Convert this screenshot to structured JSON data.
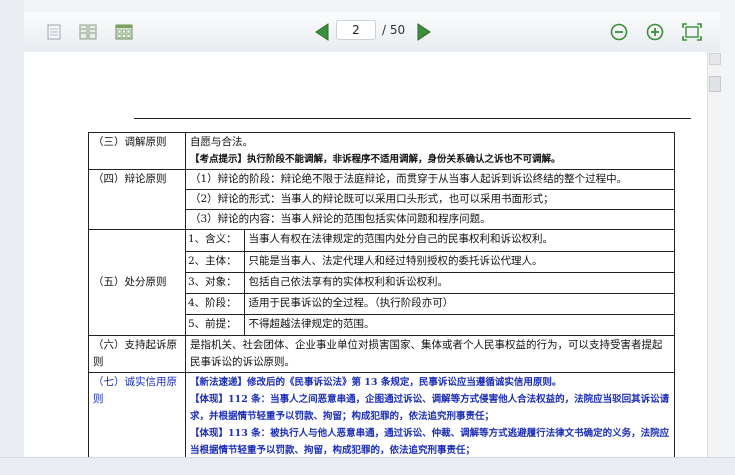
{
  "toolbar": {
    "icons": [
      "single-page-icon",
      "two-page-icon",
      "thumbnail-grid-icon"
    ],
    "prev_icon": "arrow-left-icon",
    "next_icon": "arrow-right-icon",
    "page_current": "2",
    "page_total": "/ 50",
    "zoom_out_icon": "zoom-out-icon",
    "zoom_in_icon": "zoom-in-icon",
    "fullscreen_icon": "fullscreen-icon",
    "accent": "#3c8f3a"
  },
  "doc": {
    "rows": [
      {
        "head": "（三）调解原则",
        "lines": [
          {
            "text": "自愿与合法。"
          },
          {
            "text": "【考点提示】执行阶段不能调解，非诉程序不适用调解，身份关系确认之诉也不可调解。",
            "small": true
          }
        ]
      },
      {
        "head": "（四）辩论原则",
        "lines": [
          {
            "text": "（1）辩论的阶段：辩论绝不限于法庭辩论，而贯穿于从当事人起诉到诉讼终结的整个过程中。"
          },
          {
            "text": "（2）辩论的形式：当事人的辩论既可以采用口头形式，也可以采用书面形式；"
          },
          {
            "text": "（3）辩论的内容：当事人辩论的范围包括实体问题和程序问题。"
          }
        ]
      },
      {
        "head": "（五）处分原则",
        "items": [
          {
            "k": "1、含义：",
            "v": "当事人有权在法律规定的范围内处分自己的民事权利和诉讼权利。"
          },
          {
            "k": "2、主体：",
            "v": "只能是当事人、法定代理人和经过特别授权的委托诉讼代理人。"
          },
          {
            "k": "3、对象：",
            "v": "包括自己依法享有的实体权利和诉讼权利。"
          },
          {
            "k": "4、阶段：",
            "v": "适用于民事诉讼的全过程。（执行阶段亦可）"
          },
          {
            "k": "5、前提：",
            "v": "不得超越法律规定的范围。"
          }
        ]
      },
      {
        "head": "（六）支持起诉原则",
        "lines": [
          {
            "text": "是指机关、社会团体、企业事业单位对损害国家、集体或者个人民事权益的行为，可以支持受害者提起民事诉讼的诉讼原则。"
          }
        ]
      },
      {
        "head": "（七）诚实信用原则",
        "blue": true,
        "lines": [
          {
            "text": "【新法速递】修改后的《民事诉讼法》第 13 条规定，民事诉讼应当遵循诚实信用原则。",
            "small": true
          },
          {
            "text": "【体现】112 条：当事人之间恶意串通，企图通过诉讼、调解等方式侵害他人合法权益的，法院应当驳回其诉讼请求，并根据情节轻重予以罚款、拘留；构成犯罪的，依法追究刑事责任；",
            "small": true
          },
          {
            "text": "【体现】113 条：被执行人与他人恶意串通，通过诉讼、仲裁、调解等方式逃避履行法律文书确定的义务，法院应当根据情节轻重予以罚款、拘留，构成犯罪的，依法追究刑事责任；",
            "small": true
          }
        ]
      }
    ]
  }
}
